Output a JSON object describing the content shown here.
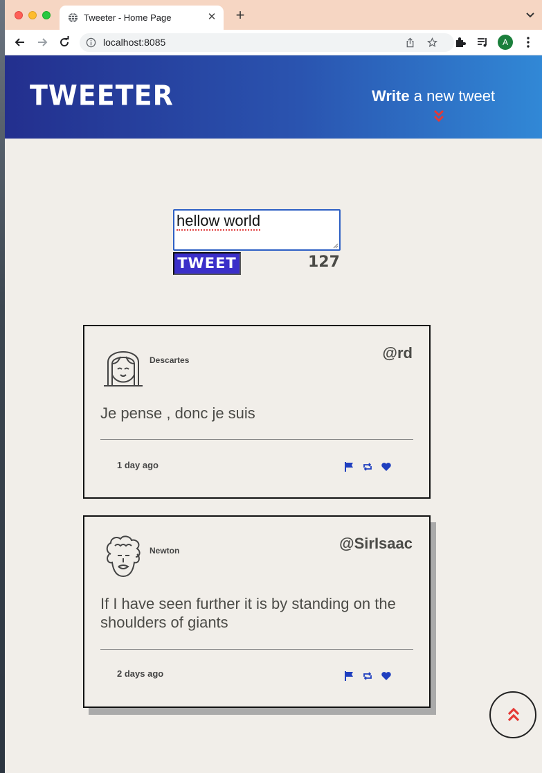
{
  "browser": {
    "tab_title": "Tweeter - Home Page",
    "url": "localhost:8085",
    "profile_initial": "A"
  },
  "header": {
    "logo": "TWEETER",
    "write_bold": "Write",
    "write_rest": " a new tweet"
  },
  "compose": {
    "text": "hellow world",
    "button_label": "TWEET",
    "char_counter": "127"
  },
  "tweets": [
    {
      "name": "Descartes",
      "handle": "@rd",
      "body": "Je pense , donc je suis",
      "time": "1 day ago"
    },
    {
      "name": "Newton",
      "handle": "@SirIsaac",
      "body": "If I have seen further it is by standing on the shoulders of giants",
      "time": "2 days ago"
    }
  ],
  "colors": {
    "header_start": "#232f8e",
    "header_end": "#3188d6",
    "accent_red": "#e53935",
    "tweet_button": "#3b2fc9",
    "action_icon": "#1f3fbf"
  }
}
